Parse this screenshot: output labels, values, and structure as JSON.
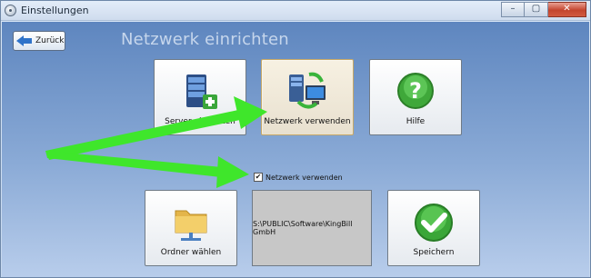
{
  "window": {
    "title": "Einstellungen",
    "controls": {
      "minimize": "–",
      "maximize": "▢",
      "close": "✕"
    }
  },
  "toolbar": {
    "back_label": "Zurück"
  },
  "page": {
    "heading": "Netzwerk einrichten"
  },
  "tiles": {
    "server": {
      "label": "Server einrichten",
      "icon": "server-add-icon"
    },
    "network": {
      "label": "Netzwerk verwenden",
      "icon": "network-computer-icon"
    },
    "help": {
      "label": "Hilfe",
      "icon": "help-icon"
    },
    "folder": {
      "label": "Ordner wählen",
      "icon": "network-folder-icon"
    },
    "save": {
      "label": "Speichern",
      "icon": "checkmark-icon"
    }
  },
  "network_checkbox": {
    "label": "Netzwerk verwenden",
    "checked": true,
    "mark": "✔"
  },
  "path": {
    "value": "S:\\PUBLIC\\Software\\KingBill GmbH"
  },
  "colors": {
    "annotation_arrow": "#3fe62b",
    "selected_tile": "#e8e0cf",
    "background_top": "#5e86bf",
    "background_bottom": "#b8cdeb"
  }
}
